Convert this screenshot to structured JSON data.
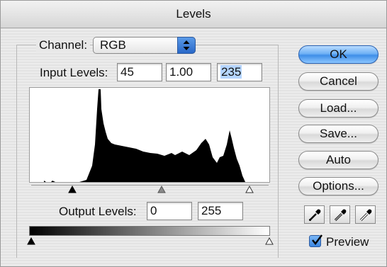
{
  "window": {
    "title": "Levels"
  },
  "channel": {
    "label": "Channel:",
    "value": "RGB"
  },
  "input_levels": {
    "label": "Input Levels:",
    "black": "45",
    "gamma": "1.00",
    "white": "235"
  },
  "output_levels": {
    "label": "Output Levels:",
    "black": "0",
    "white": "255"
  },
  "buttons": {
    "ok": "OK",
    "cancel": "Cancel",
    "load": "Load...",
    "save": "Save...",
    "auto": "Auto",
    "options": "Options..."
  },
  "preview": {
    "label": "Preview",
    "checked": true
  },
  "eyedroppers": [
    "black-eyedropper-icon",
    "gray-eyedropper-icon",
    "white-eyedropper-icon"
  ],
  "colors": {
    "accent": "#3f8ee8",
    "histogram": "#000000"
  }
}
